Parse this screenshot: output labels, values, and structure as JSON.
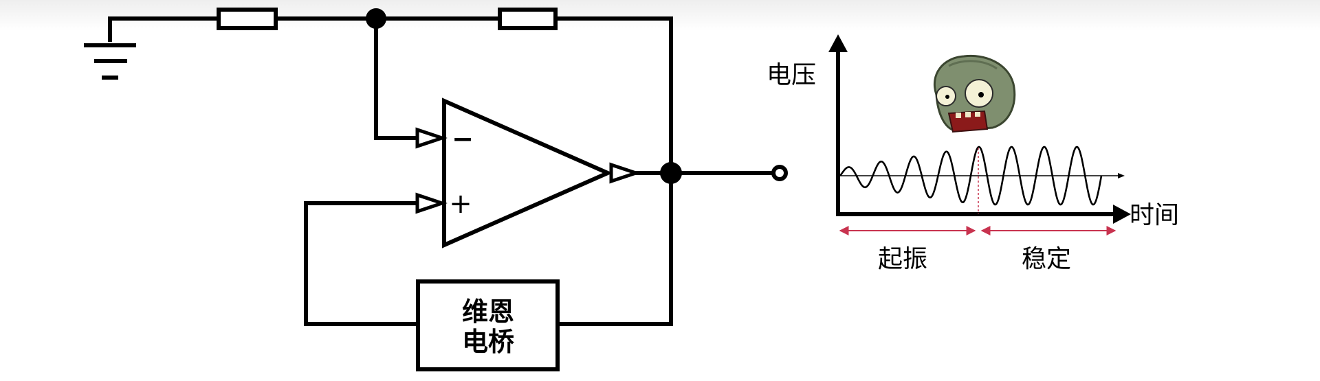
{
  "circuit": {
    "opamp_minus": "−",
    "opamp_plus": "+",
    "bridge_line1": "维恩",
    "bridge_line2": "电桥"
  },
  "waveform": {
    "ylabel": "电压",
    "xlabel": "时间",
    "phase_startup": "起振",
    "phase_stable": "稳定",
    "character_icon": "zombie-head-icon",
    "colors": {
      "axis": "#000000",
      "wave": "#000000",
      "phase_arrow": "#c8334f",
      "zombie_skin": "#7f8f6f",
      "zombie_mouth": "#8b1a1a"
    }
  }
}
